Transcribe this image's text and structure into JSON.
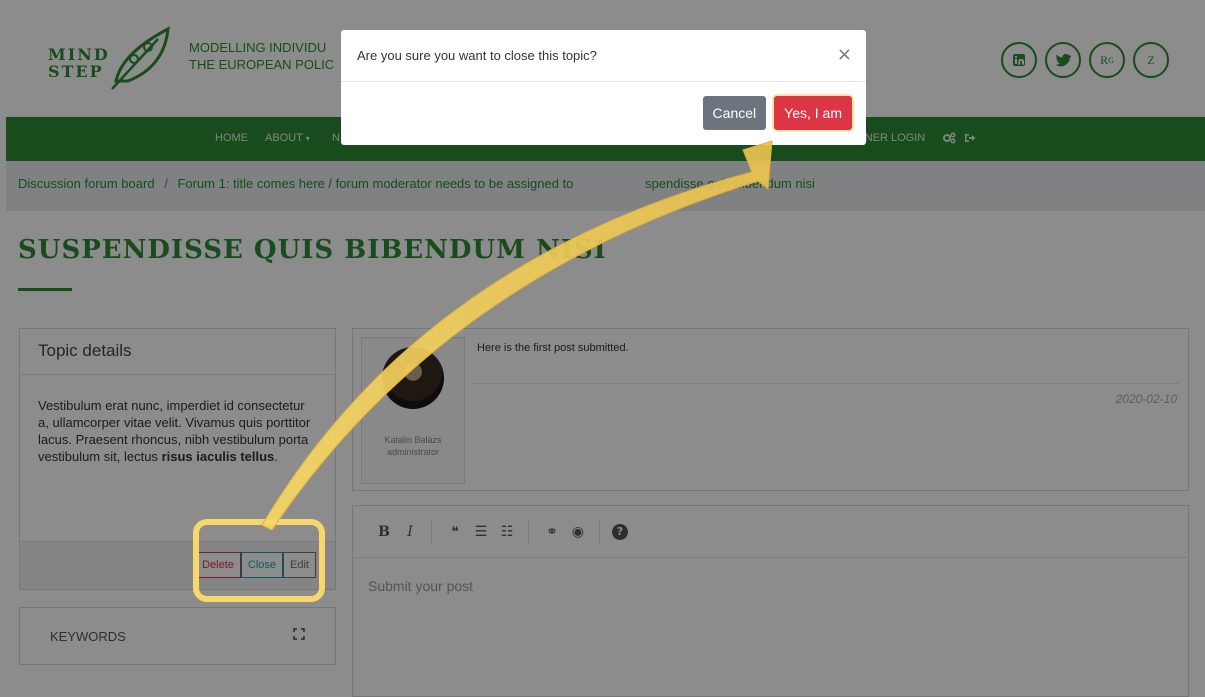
{
  "header": {
    "logo_line1": "MIND",
    "logo_line2": "STEP",
    "tagline_line1": "MODELLING INDIVIDU",
    "tagline_line2": "THE EUROPEAN POLIC",
    "socials": [
      "linkedin-icon",
      "twitter-icon",
      "researchgate-icon",
      "zenodo-icon"
    ],
    "social_rg": "R",
    "social_rg_sup": "G",
    "social_z": "Z"
  },
  "nav": {
    "home": "HOME",
    "about": "ABOUT",
    "about_caret": "▾",
    "n": "N",
    "partner_login": "TNER LOGIN"
  },
  "breadcrumb": {
    "root": "Discussion forum board",
    "separator": "/",
    "rest": "Forum 1: title comes here / forum moderator needs to be assigned to",
    "end": "spendisse quis bibendum nisi"
  },
  "page": {
    "title": "SUSPENDISSE QUIS BIBENDUM NISI"
  },
  "topic": {
    "header": "Topic details",
    "body_text": "Vestibulum erat nunc, imperdiet id consectetur a, ullamcorper vitae velit. Vivamus quis porttitor lacus. Praesent rhoncus, nibh vestibulum porta vestibulum sit, lectus",
    "body_bold": "risus iaculis tellus",
    "body_end": ".",
    "delete_label": "Delete",
    "close_label": "Close",
    "edit_label": "Edit"
  },
  "keywords": {
    "label": "KEYWORDS"
  },
  "post": {
    "author_name": "Katalin Balázs",
    "author_role": "administrator",
    "text": "Here is the first post submitted.",
    "date": "2020-02-10"
  },
  "editor": {
    "placeholder": "Submit your post",
    "tools": {
      "bold": "B",
      "italic": "I",
      "quote": "❝",
      "ul": "☰",
      "ol": "☷",
      "link": "⚭",
      "preview": "◉",
      "help": "?"
    }
  },
  "modal": {
    "title": "Are you sure you want to close this topic?",
    "close_glyph": "×",
    "cancel_label": "Cancel",
    "confirm_label": "Yes, I am"
  },
  "colors": {
    "brand_green": "#2d8a34",
    "danger": "#dc3545",
    "secondary": "#6c757d",
    "info": "#17a2b8",
    "annotation_yellow": "#f5d76e"
  }
}
